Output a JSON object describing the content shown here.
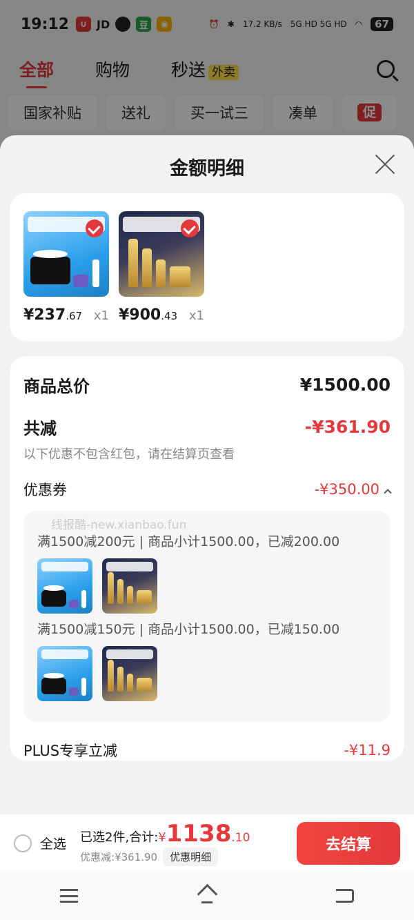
{
  "status_bar": {
    "time": "19:12",
    "network": "17.2 KB/s",
    "signal": "5G HD 5G HD",
    "battery": "67"
  },
  "tabs": [
    {
      "label": "全部",
      "active": true
    },
    {
      "label": "购物"
    },
    {
      "label": "秒送",
      "badge": "外卖"
    }
  ],
  "chips": [
    "国家补贴",
    "送礼",
    "买一试三",
    "凑单",
    "促"
  ],
  "sheet": {
    "title": "金额明细",
    "products": [
      {
        "price_int": "¥237",
        "price_dec": ".67",
        "qty": "x1"
      },
      {
        "price_int": "¥900",
        "price_dec": ".43",
        "qty": "x1"
      }
    ],
    "total_label": "商品总价",
    "total_value": "¥1500.00",
    "reduce_label": "共减",
    "reduce_value": "-¥361.90",
    "reduce_note": "以下优惠不包含红包，请在结算页查看",
    "coupon_label": "优惠券",
    "coupon_value": "-¥350.00",
    "watermark": "线报酷-new.xianbao.fun",
    "coupons": [
      "满1500减200元 | 商品小计1500.00，已减200.00",
      "满1500减150元 | 商品小计1500.00，已减150.00"
    ],
    "plus_label": "PLUS专享立减",
    "plus_value": "-¥11.9"
  },
  "bottom_bar": {
    "select_all": "全选",
    "selected_prefix": "已选2件,合计:",
    "currency": "¥",
    "total_int": "1138",
    "total_dec": ".10",
    "discount": "优惠减:¥361.90",
    "detail_button": "优惠明细",
    "checkout": "去结算"
  },
  "colors": {
    "accent": "#e4393c",
    "sheet_bg": "#f2f2f2",
    "card_bg": "#ffffff"
  }
}
